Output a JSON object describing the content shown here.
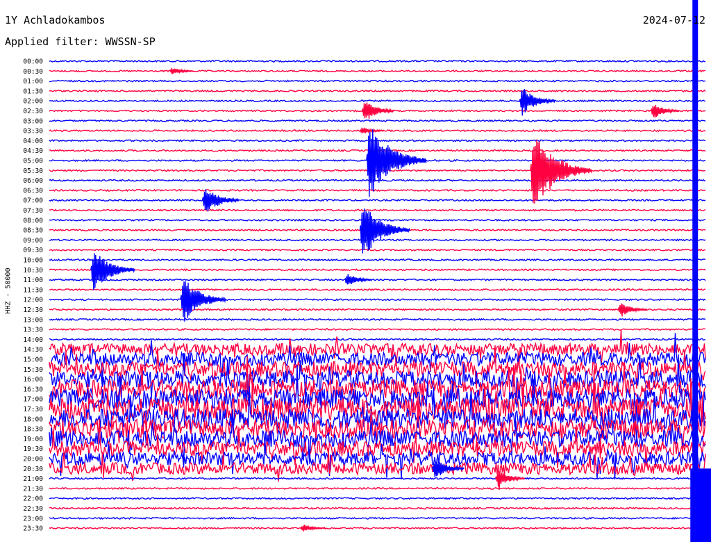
{
  "header": {
    "station": "1Y Achladokambos",
    "date": "2024-07-12",
    "filter_label": "Applied filter: WWSSN-SP"
  },
  "channel_label": "HHZ - 50000",
  "colors": {
    "even_trace": "#0000ff",
    "odd_trace": "#ff0040"
  },
  "chart_data": {
    "type": "line",
    "title": "1Y Achladokambos",
    "subtitle": "Applied filter: WWSSN-SP",
    "ylabel": "HHZ - 50000",
    "xlabel": "",
    "grid": false,
    "legend": "none",
    "row_labels": [
      "00:00",
      "00:30",
      "01:00",
      "01:30",
      "02:00",
      "02:30",
      "03:00",
      "03:30",
      "04:00",
      "04:30",
      "05:00",
      "05:30",
      "06:00",
      "06:30",
      "07:00",
      "07:30",
      "08:00",
      "08:30",
      "09:00",
      "09:30",
      "10:00",
      "10:30",
      "11:00",
      "11:30",
      "12:00",
      "12:30",
      "13:00",
      "13:30",
      "14:00",
      "14:30",
      "15:00",
      "15:30",
      "16:00",
      "16:30",
      "17:00",
      "17:30",
      "18:00",
      "18:30",
      "19:00",
      "19:30",
      "20:00",
      "20:30",
      "21:00",
      "21:30",
      "22:00",
      "22:30",
      "23:00",
      "23:30"
    ],
    "events": [
      {
        "row": "00:30",
        "minute": 5.5,
        "amplitude": 0.4,
        "color": "odd"
      },
      {
        "row": "02:00",
        "minute": 21.5,
        "amplitude": 1.5,
        "color": "even"
      },
      {
        "row": "02:30",
        "minute": 14.3,
        "amplitude": 1.2,
        "color": "odd"
      },
      {
        "row": "02:30",
        "minute": 27.5,
        "amplitude": 0.8,
        "color": "odd"
      },
      {
        "row": "03:30",
        "minute": 14.2,
        "amplitude": 0.4,
        "color": "odd"
      },
      {
        "row": "05:00",
        "minute": 14.5,
        "amplitude": 4.0,
        "color": "even"
      },
      {
        "row": "05:30",
        "minute": 22.0,
        "amplitude": 4.2,
        "color": "odd"
      },
      {
        "row": "06:30",
        "minute": 31.5,
        "amplitude": 1.4,
        "color": "odd"
      },
      {
        "row": "07:00",
        "minute": 7.0,
        "amplitude": 1.6,
        "color": "even"
      },
      {
        "row": "08:30",
        "minute": 14.2,
        "amplitude": 3.0,
        "color": "even"
      },
      {
        "row": "10:30",
        "minute": 1.9,
        "amplitude": 2.4,
        "color": "even"
      },
      {
        "row": "11:00",
        "minute": 13.5,
        "amplitude": 0.7,
        "color": "even"
      },
      {
        "row": "12:00",
        "minute": 6.0,
        "amplitude": 2.5,
        "color": "even"
      },
      {
        "row": "12:30",
        "minute": 26.0,
        "amplitude": 0.8,
        "color": "odd"
      },
      {
        "row": "20:30",
        "minute": 17.5,
        "amplitude": 1.2,
        "color": "even"
      },
      {
        "row": "21:00",
        "minute": 20.4,
        "amplitude": 0.9,
        "color": "odd"
      },
      {
        "row": "23:30",
        "minute": 11.5,
        "amplitude": 0.4,
        "color": "odd"
      }
    ],
    "noisy_period": {
      "start": "14:30",
      "end": "20:30"
    },
    "saturated_trace_minute": 29.5
  }
}
